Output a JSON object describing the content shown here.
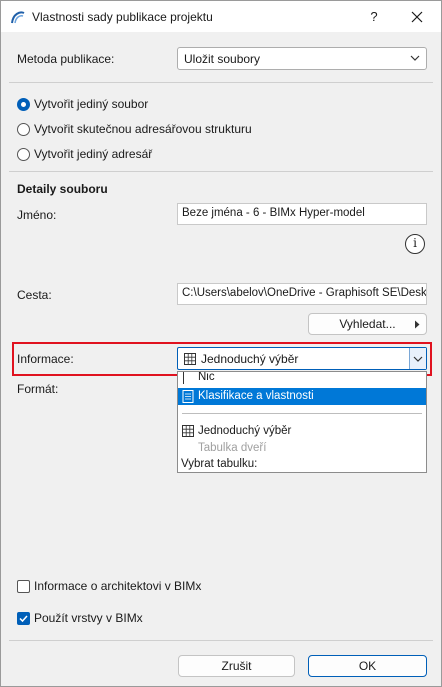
{
  "window": {
    "title": "Vlastnosti sady publikace projektu",
    "help_label": "?"
  },
  "method": {
    "label": "Metoda publikace:",
    "value": "Uložit soubory"
  },
  "radios": [
    {
      "label": "Vytvořit jediný soubor",
      "checked": true
    },
    {
      "label": "Vytvořit skutečnou adresářovou strukturu",
      "checked": false
    },
    {
      "label": "Vytvořit jediný adresář",
      "checked": false
    }
  ],
  "details": {
    "heading": "Detaily souboru",
    "name_label": "Jméno:",
    "name_value": "Beze jména - 6 - BIMx Hyper-model",
    "info_icon_glyph": "i",
    "path_label": "Cesta:",
    "path_value": "C:\\Users\\abelov\\OneDrive - Graphisoft SE\\Desktop",
    "browse_label": "Vyhledat..."
  },
  "information": {
    "label": "Informace:",
    "value": "Jednoduchý výběr",
    "format_label": "Formát:",
    "options": [
      {
        "label": "Nic",
        "state": "partial"
      },
      {
        "label": "Klasifikace a vlastnosti",
        "state": "selected"
      },
      {
        "label": "Jednoduchý výběr",
        "state": "normal"
      },
      {
        "label": "Tabulka dveří",
        "state": "disabled"
      },
      {
        "label": "Vybrat tabulku:",
        "state": "normal"
      }
    ]
  },
  "checkboxes": [
    {
      "label": "Informace o architektovi v BIMx",
      "checked": false
    },
    {
      "label": "Použít vrstvy v BIMx",
      "checked": true
    }
  ],
  "footer": {
    "cancel_label": "Zrušit",
    "ok_label": "OK"
  },
  "colors": {
    "accent": "#005fb8",
    "highlight": "#e0121f",
    "selection": "#0078d7"
  }
}
